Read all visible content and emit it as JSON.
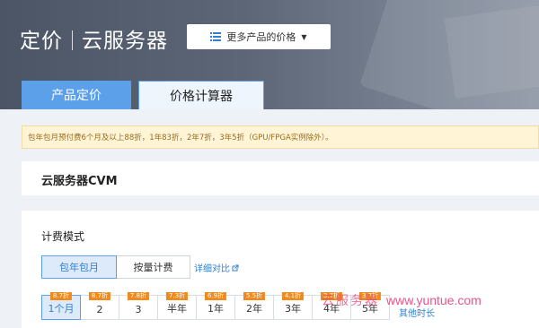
{
  "header": {
    "title": "定价",
    "subtitle": "云服务器",
    "more_products": "更多产品的价格"
  },
  "tabs": [
    {
      "label": "产品定价",
      "active": false
    },
    {
      "label": "价格计算器",
      "active": true
    }
  ],
  "notice": "包年包月预付费6个月及以上88折，1年83折，2年7折，3年5折（GPU/FPGA实例除外）。",
  "product": {
    "name": "云服务器CVM"
  },
  "billing": {
    "label": "计费模式",
    "modes": [
      "包年包月",
      "按量计费"
    ],
    "compare_link": "详细对比"
  },
  "durations": [
    {
      "label": "1个月",
      "discount": "8.7折"
    },
    {
      "label": "2",
      "discount": "8.7折"
    },
    {
      "label": "3",
      "discount": "7.8折"
    },
    {
      "label": "半年",
      "discount": "7.3折"
    },
    {
      "label": "1年",
      "discount": "6.9折"
    },
    {
      "label": "2年",
      "discount": "5.5折"
    },
    {
      "label": "3年",
      "discount": "4.1折"
    },
    {
      "label": "4年",
      "discount": "3.7折"
    },
    {
      "label": "5年",
      "discount": "3.7折"
    }
  ],
  "other_durations": "其他时长",
  "watermark": {
    "cn": "云服务器",
    "url": "www.yuntue.com"
  },
  "colors": {
    "accent": "#5ba0e8",
    "badge": "#f08a1c",
    "notice_bg": "#fff5d6",
    "link": "#2f7fd6"
  }
}
